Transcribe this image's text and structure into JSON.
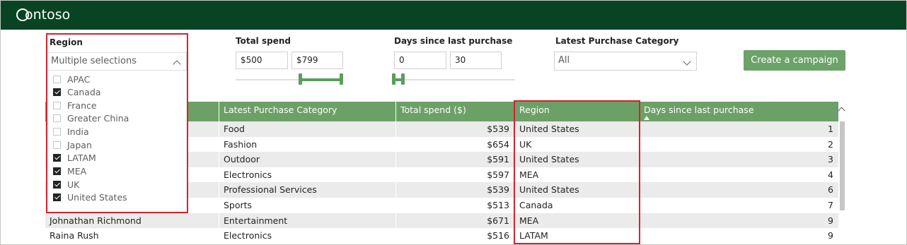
{
  "brand": {
    "logo_text": "ontoso",
    "logo_mark": "C",
    "header_color": "#084423"
  },
  "filters": {
    "region": {
      "label": "Region",
      "placeholder": "Multiple selections",
      "options": [
        {
          "label": "APAC",
          "checked": false
        },
        {
          "label": "Canada",
          "checked": true
        },
        {
          "label": "France",
          "checked": false
        },
        {
          "label": "Greater China",
          "checked": false
        },
        {
          "label": "India",
          "checked": false
        },
        {
          "label": "Japan",
          "checked": false
        },
        {
          "label": "LATAM",
          "checked": true
        },
        {
          "label": "MEA",
          "checked": true
        },
        {
          "label": "UK",
          "checked": true
        },
        {
          "label": "United States",
          "checked": true
        }
      ]
    },
    "total_spend": {
      "label": "Total spend",
      "min": "$500",
      "max": "$799"
    },
    "days_since": {
      "label": "Days since last purchase",
      "min": "0",
      "max": "30"
    },
    "category": {
      "label": "Latest Purchase Category",
      "value": "All"
    }
  },
  "actions": {
    "create_campaign": "Create a campaign"
  },
  "table": {
    "columns": [
      "",
      "Latest Purchase Category",
      "Total spend ($)",
      "Region",
      "Days since last purchase"
    ],
    "rows": [
      [
        "",
        "Food",
        "$539",
        "United States",
        "1"
      ],
      [
        "",
        "Fashion",
        "$654",
        "UK",
        "2"
      ],
      [
        "",
        "Outdoor",
        "$591",
        "United States",
        "3"
      ],
      [
        "",
        "Electronics",
        "$597",
        "MEA",
        "4"
      ],
      [
        "",
        "Professional Services",
        "$539",
        "United States",
        "6"
      ],
      [
        "",
        "Sports",
        "$513",
        "Canada",
        "7"
      ],
      [
        "Johnathan Richmond",
        "Entertainment",
        "$671",
        "MEA",
        "9"
      ],
      [
        "Raina Rush",
        "Electronics",
        "$516",
        "LATAM",
        "9"
      ]
    ]
  },
  "colors": {
    "accent": "#6da067",
    "highlight": "#d6222e"
  }
}
